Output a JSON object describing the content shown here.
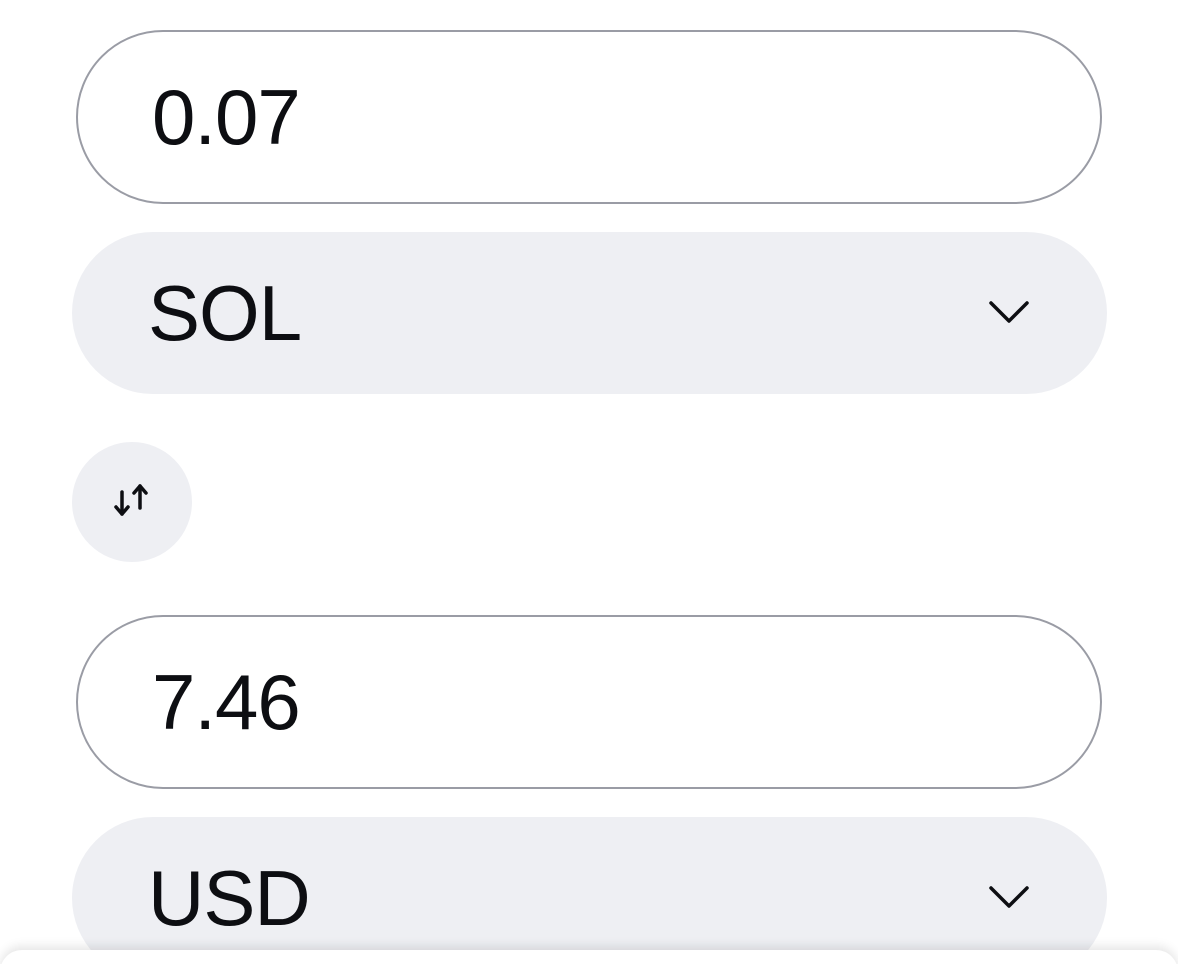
{
  "converter": {
    "from": {
      "amount": "0.07",
      "currency": "SOL"
    },
    "to": {
      "amount": "7.46",
      "currency": "USD"
    }
  },
  "icons": {
    "dropdown": "chevron-down-icon",
    "swap": "swap-vertical-icon"
  },
  "colors": {
    "field_border": "#9a9ca5",
    "select_background": "#eeeff3",
    "text": "#0d0e12"
  }
}
